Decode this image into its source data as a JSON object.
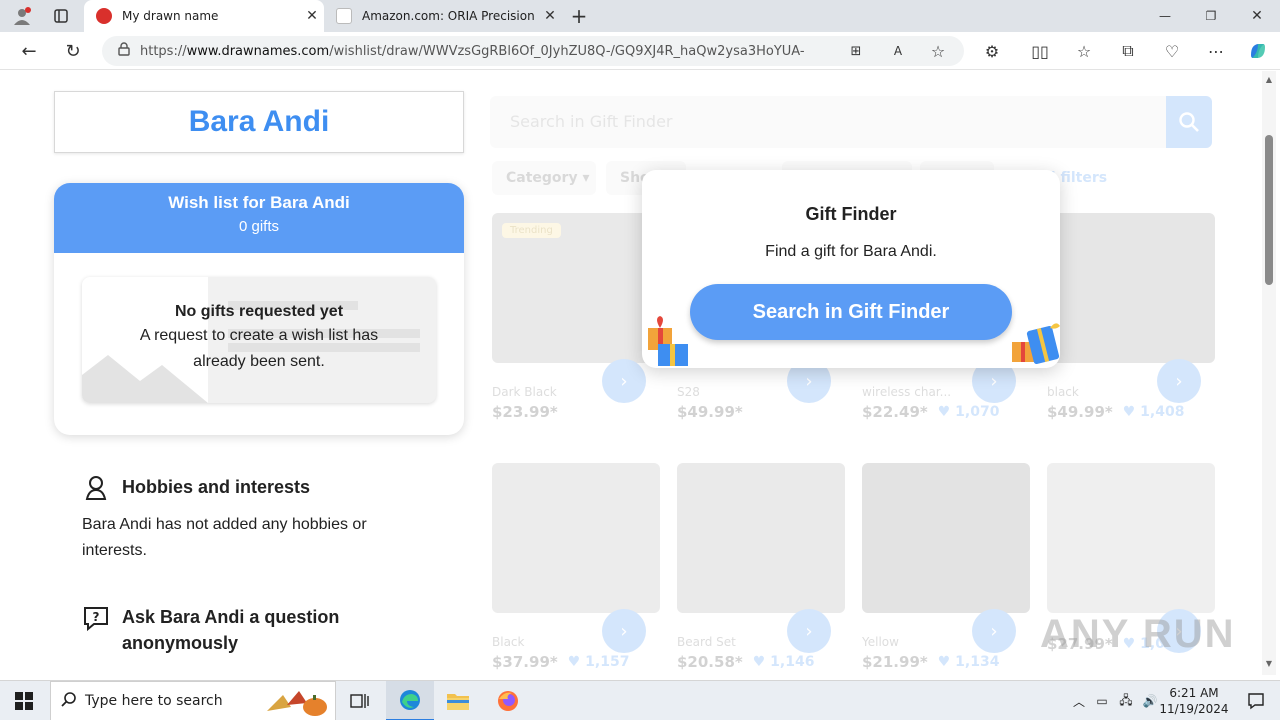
{
  "browser": {
    "tabs": [
      {
        "title": "My drawn name",
        "active": true
      },
      {
        "title": "Amazon.com: ORIA Precision Sc",
        "active": false
      }
    ],
    "new_tab_label": "+",
    "url_prefix": "https://",
    "url_domain": "www.drawnames.com",
    "url_path": "/wishlist/draw/WWVzsGgRBl6Of_0JyhZU8Q-/GQ9XJ4R_haQw2ysa3HoYUA-",
    "window_controls": [
      "—",
      "❐",
      "✕"
    ]
  },
  "page": {
    "person_name": "Bara Andi",
    "wishlist": {
      "title": "Wish list for Bara Andi",
      "count": "0 gifts",
      "empty_heading": "No gifts requested yet",
      "empty_text": "A request to create a wish list has already been sent."
    },
    "hobbies": {
      "heading": "Hobbies and interests",
      "text": "Bara Andi has not added any hobbies or interests."
    },
    "question": {
      "heading": "Ask Bara Andi a question anonymously"
    }
  },
  "gift_finder": {
    "search_placeholder": "Search in Gift Finder",
    "filters": [
      "Category",
      "Sho",
      "",
      "",
      "ll filters"
    ],
    "products": [
      {
        "name": "Dark Black",
        "price": "$23.99*",
        "likes": "",
        "badge": "Trending"
      },
      {
        "name": "S28",
        "price": "$49.99*",
        "likes": "",
        "badge": ""
      },
      {
        "name": "wireless char...",
        "price": "$22.49*",
        "likes": "1,070",
        "badge": ""
      },
      {
        "name": "black",
        "price": "$49.99*",
        "likes": "1,408",
        "badge": ""
      },
      {
        "name": "Black",
        "price": "$37.99*",
        "likes": "1,157",
        "badge": ""
      },
      {
        "name": "Beard Set",
        "price": "$20.58*",
        "likes": "1,146",
        "badge": ""
      },
      {
        "name": "Yellow",
        "price": "$21.99*",
        "likes": "1,134",
        "badge": ""
      },
      {
        "name": "",
        "price": "$27.99*",
        "likes": "1,093",
        "badge": ""
      }
    ]
  },
  "popup": {
    "title": "Gift Finder",
    "subtitle": "Find a gift for Bara Andi.",
    "button": "Search in Gift Finder"
  },
  "watermark": "ANY RUN",
  "taskbar": {
    "search_placeholder": "Type here to search",
    "time": "6:21 AM",
    "date": "11/19/2024"
  },
  "colors": {
    "brand_blue": "#3e8ef1",
    "header_blue": "#5b9cf5"
  }
}
